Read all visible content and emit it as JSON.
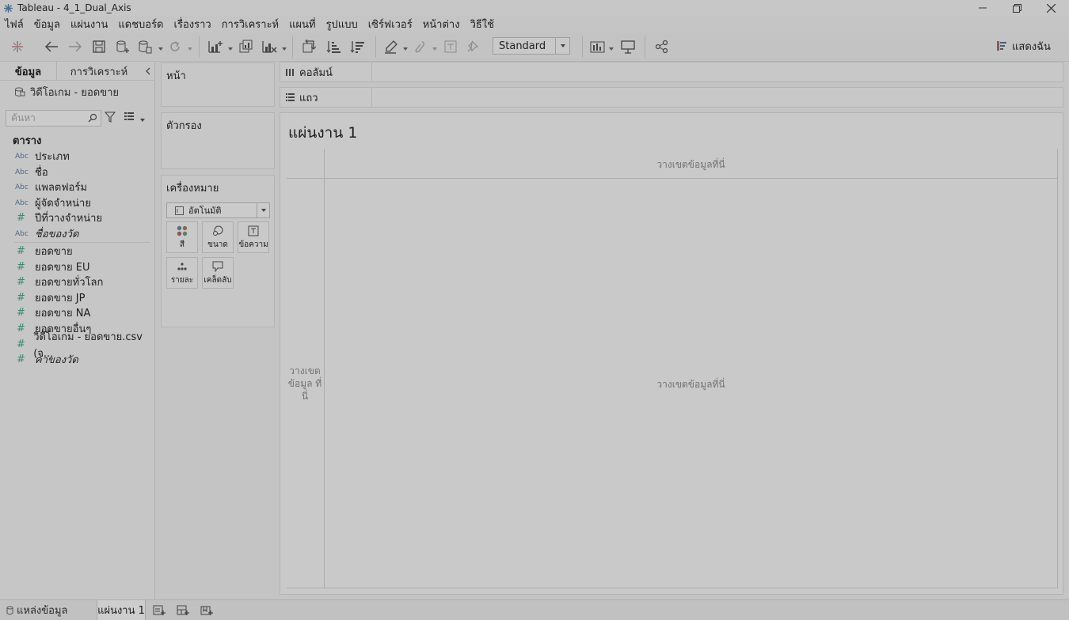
{
  "window": {
    "title": "Tableau - 4_1_Dual_Axis"
  },
  "menubar": {
    "items": [
      "ไฟล์",
      "ข้อมูล",
      "แผ่นงาน",
      "แดชบอร์ด",
      "เรื่องราว",
      "การวิเคราะห์",
      "แผนที่",
      "รูปแบบ",
      "เซิร์ฟเวอร์",
      "หน้าต่าง",
      "วิธีใช้"
    ]
  },
  "toolbar": {
    "fit_value": "Standard",
    "show_me_label": "แสดงฉัน"
  },
  "data_pane": {
    "tab_data": "ข้อมูล",
    "tab_analytics": "การวิเคราะห์",
    "datasource": "วิดีโอเกม - ยอดขาย",
    "search_placeholder": "ค้นหา",
    "tables_heading": "ตาราง",
    "type_text": "Abc",
    "type_number": "#",
    "dimensions": [
      "ประเภท",
      "ชื่อ",
      "แพลตฟอร์ม",
      "ผู้จัดจำหน่าย",
      "ปีที่วางจำหน่าย",
      "ชื่อของวัด"
    ],
    "measures": [
      "ยอดขาย",
      "ยอดขาย EU",
      "ยอดขายทั่วโลก",
      "ยอดขาย JP",
      "ยอดขาย NA",
      "ยอดขายอื่นๆ",
      "วิดีโอเกม - ยอดขาย.csv (จ...",
      "ค่าของวัด"
    ]
  },
  "cards": {
    "pages_title": "หน้า",
    "filters_title": "ตัวกรอง",
    "marks_title": "เครื่องหมาย",
    "marks_type": "อัตโนมัติ",
    "mark_buttons": [
      "สี",
      "ขนาด",
      "ข้อความ",
      "รายละ",
      "เคล็ดลับ"
    ]
  },
  "shelves": {
    "columns_label": "คอลัมน์",
    "rows_label": "แถว"
  },
  "canvas": {
    "sheet_title": "แผ่นงาน 1",
    "drop_top": "วางเขตข้อมูลที่นี่",
    "drop_center": "วางเขตข้อมูลที่นี่",
    "drop_left": "วางเขต ข้อมูล ที่นี่"
  },
  "statusbar": {
    "datasource_tab": "แหล่งข้อมูล",
    "sheet_tab": "แผ่นงาน 1"
  }
}
